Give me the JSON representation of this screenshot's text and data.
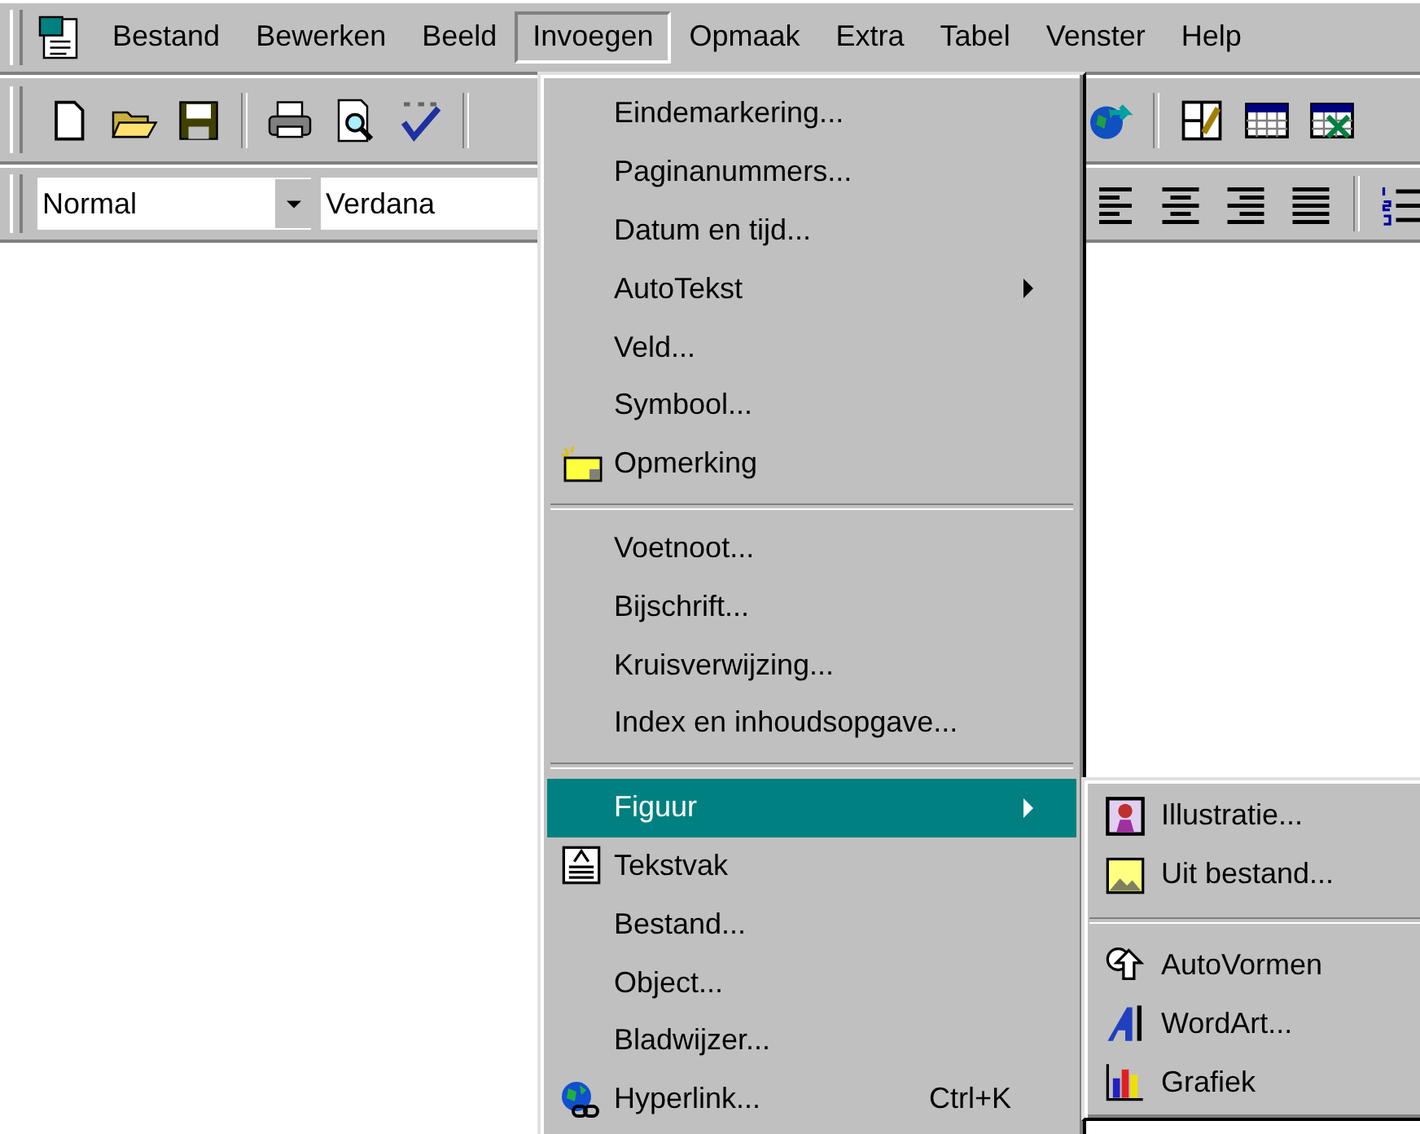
{
  "menubar": {
    "items": [
      {
        "label": "Bestand",
        "selected": false
      },
      {
        "label": "Bewerken",
        "selected": false
      },
      {
        "label": "Beeld",
        "selected": false
      },
      {
        "label": "Invoegen",
        "selected": true
      },
      {
        "label": "Opmaak",
        "selected": false
      },
      {
        "label": "Extra",
        "selected": false
      },
      {
        "label": "Tabel",
        "selected": false
      },
      {
        "label": "Venster",
        "selected": false
      },
      {
        "label": "Help",
        "selected": false
      }
    ]
  },
  "formatting_toolbar": {
    "style": "Normal",
    "font": "Verdana"
  },
  "menu": {
    "items": [
      {
        "kind": "item",
        "label": "Eindemarkering...",
        "selected": false,
        "has_submenu": false
      },
      {
        "kind": "item",
        "label": "Paginanummers...",
        "selected": false,
        "has_submenu": false
      },
      {
        "kind": "item",
        "label": "Datum en tijd...",
        "selected": false,
        "has_submenu": false
      },
      {
        "kind": "item",
        "label": "AutoTekst",
        "selected": false,
        "has_submenu": true
      },
      {
        "kind": "item",
        "label": "Veld...",
        "selected": false,
        "has_submenu": false
      },
      {
        "kind": "item",
        "label": "Symbool...",
        "selected": false,
        "has_submenu": false
      },
      {
        "kind": "item",
        "label": "Opmerking",
        "selected": false,
        "has_submenu": false
      },
      {
        "kind": "separator"
      },
      {
        "kind": "item",
        "label": "Voetnoot...",
        "selected": false,
        "has_submenu": false
      },
      {
        "kind": "item",
        "label": "Bijschrift...",
        "selected": false,
        "has_submenu": false
      },
      {
        "kind": "item",
        "label": "Kruisverwijzing...",
        "selected": false,
        "has_submenu": false
      },
      {
        "kind": "item",
        "label": "Index en inhoudsopgave...",
        "selected": false,
        "has_submenu": false
      },
      {
        "kind": "separator"
      },
      {
        "kind": "item",
        "label": "Figuur",
        "selected": true,
        "has_submenu": true
      },
      {
        "kind": "item",
        "label": "Tekstvak",
        "selected": false,
        "has_submenu": false
      },
      {
        "kind": "item",
        "label": "Bestand...",
        "selected": false,
        "has_submenu": false
      },
      {
        "kind": "item",
        "label": "Object...",
        "selected": false,
        "has_submenu": false
      },
      {
        "kind": "item",
        "label": "Bladwijzer...",
        "selected": false,
        "has_submenu": false
      },
      {
        "kind": "item",
        "label": "Hyperlink...",
        "selected": false,
        "has_submenu": false,
        "shortcut": "Ctrl+K"
      }
    ]
  },
  "submenu": {
    "items": [
      {
        "kind": "item",
        "label": "Illustratie..."
      },
      {
        "kind": "item",
        "label": "Uit bestand..."
      },
      {
        "kind": "separator"
      },
      {
        "kind": "item",
        "label": "AutoVormen"
      },
      {
        "kind": "item",
        "label": "WordArt..."
      },
      {
        "kind": "item",
        "label": "Grafiek"
      }
    ]
  }
}
